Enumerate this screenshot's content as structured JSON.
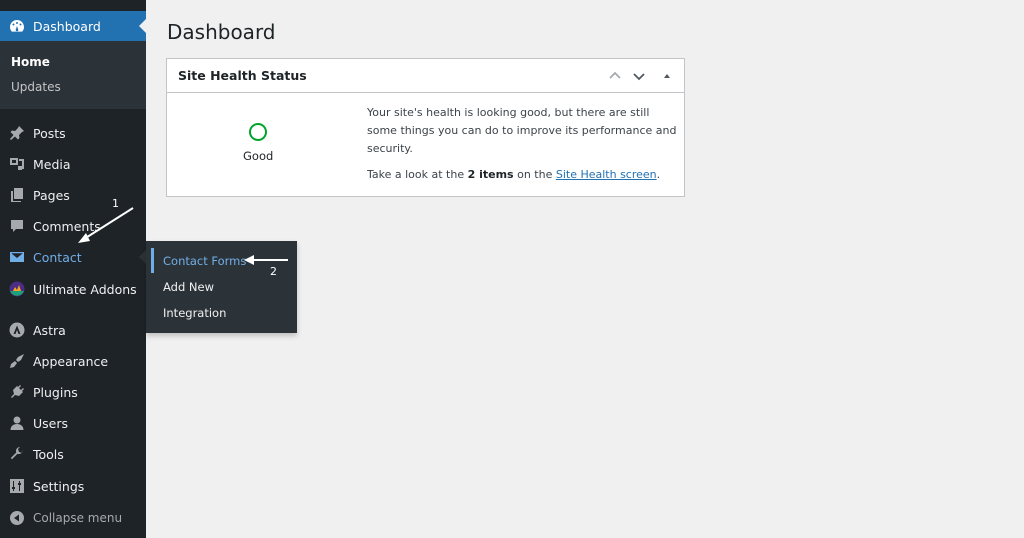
{
  "sidebar": {
    "dashboard": {
      "label": "Dashboard",
      "icon": "dashboard-gauge-icon"
    },
    "dashboard_sub": [
      {
        "label": "Home",
        "current": true
      },
      {
        "label": "Updates",
        "current": false
      }
    ],
    "items": [
      {
        "label": "Posts",
        "icon": "pushpin-icon"
      },
      {
        "label": "Media",
        "icon": "media-icon"
      },
      {
        "label": "Pages",
        "icon": "pages-icon"
      },
      {
        "label": "Comments",
        "icon": "comment-icon"
      },
      {
        "label": "Contact",
        "icon": "envelope-icon"
      },
      {
        "label": "Ultimate Addons",
        "icon": "ultimate-addons-icon"
      },
      {
        "label": "Astra",
        "icon": "astra-icon"
      },
      {
        "label": "Appearance",
        "icon": "paintbrush-icon"
      },
      {
        "label": "Plugins",
        "icon": "plug-icon"
      },
      {
        "label": "Users",
        "icon": "user-icon"
      },
      {
        "label": "Tools",
        "icon": "wrench-icon"
      },
      {
        "label": "Settings",
        "icon": "settings-sliders-icon"
      }
    ],
    "collapse": {
      "label": "Collapse menu",
      "icon": "collapse-arrow-icon"
    }
  },
  "flyout": {
    "items": [
      {
        "label": "Contact Forms",
        "active": true
      },
      {
        "label": "Add New",
        "active": false
      },
      {
        "label": "Integration",
        "active": false
      }
    ]
  },
  "main": {
    "title": "Dashboard",
    "widget": {
      "title": "Site Health Status",
      "controls": [
        "move-up-icon",
        "move-down-icon",
        "toggle-panel-icon"
      ],
      "status_label": "Good",
      "status_color": "#00a32a",
      "message": "Your site's health is looking good, but there are still some things you can do to improve its performance and security.",
      "items_prefix": "Take a look at the ",
      "items_count": "2 items",
      "items_middle": " on the ",
      "link_text": "Site Health screen",
      "items_suffix": "."
    }
  },
  "annotations": {
    "step1": "1",
    "step2": "2"
  },
  "colors": {
    "accent": "#2271b1",
    "sidebar_bg": "#1d2327",
    "submenu_bg": "#2c3338",
    "link_highlight": "#72aee6"
  }
}
